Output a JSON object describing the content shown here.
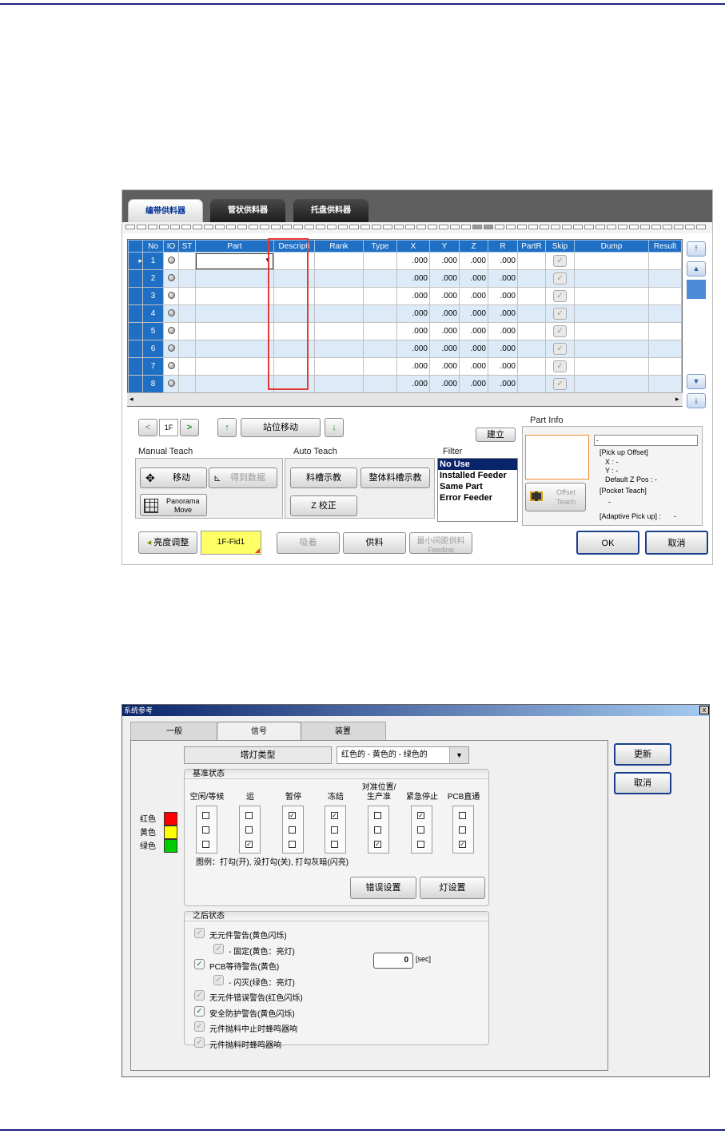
{
  "s1": {
    "tabs": [
      "编带供料器",
      "管状供料器",
      "托盘供料器"
    ],
    "columns": [
      "No",
      "IO",
      "ST",
      "Part",
      "Descripti",
      "Rank",
      "Type",
      "X",
      "Y",
      "Z",
      "R",
      "PartR",
      "Skip",
      "Dump",
      "Result"
    ],
    "rows": [
      {
        "no": "1",
        "x": ".000",
        "y": ".000",
        "z": ".000",
        "r": ".000"
      },
      {
        "no": "2",
        "x": ".000",
        "y": ".000",
        "z": ".000",
        "r": ".000"
      },
      {
        "no": "3",
        "x": ".000",
        "y": ".000",
        "z": ".000",
        "r": ".000"
      },
      {
        "no": "4",
        "x": ".000",
        "y": ".000",
        "z": ".000",
        "r": ".000"
      },
      {
        "no": "5",
        "x": ".000",
        "y": ".000",
        "z": ".000",
        "r": ".000"
      },
      {
        "no": "6",
        "x": ".000",
        "y": ".000",
        "z": ".000",
        "r": ".000"
      },
      {
        "no": "7",
        "x": ".000",
        "y": ".000",
        "z": ".000",
        "r": ".000"
      },
      {
        "no": "8",
        "x": ".000",
        "y": ".000",
        "z": ".000",
        "r": ".000"
      }
    ],
    "nav": {
      "prev": "<",
      "value": "1F",
      "next": ">",
      "up": "↑",
      "station_move": "站位移动",
      "down": "↓",
      "build": "建立"
    },
    "manual_teach": {
      "label": "Manual Teach",
      "move": "移动",
      "get_data": "得到数据",
      "panorama_1": "Panorama",
      "panorama_2": "Move"
    },
    "auto_teach": {
      "label": "Auto Teach",
      "slot_teach": "料槽示教",
      "all_slot_teach": "整体料槽示教",
      "z_correct": "Z 校正"
    },
    "filter": {
      "label": "Filter",
      "options": [
        "No Use",
        "Installed Feeder",
        "Same Part",
        "Error Feeder"
      ],
      "selected": "No Use"
    },
    "part_info": {
      "label": "Part Info",
      "value": "-",
      "pickup_offset": "[Pick up Offset]",
      "x": "X : -",
      "y": "Y : -",
      "default_z": "Default Z Pos : -",
      "pocket_teach": "[Pocket Teach]",
      "pocket_value": "-",
      "adaptive": "[Adaptive Pick up] :",
      "adaptive_value": "-",
      "offset_teach_1": "Offset",
      "offset_teach_2": "Teach"
    },
    "bottom": {
      "brightness": "亮度调整",
      "fid": "1F-Fid1",
      "pickup": "吸着",
      "supply": "供料",
      "min_feed_1": "最小间距供料",
      "min_feed_2": "Feeding",
      "ok": "OK",
      "cancel": "取消"
    }
  },
  "s2": {
    "title": "系统参考",
    "close": "x",
    "tabs": [
      "一般",
      "信号",
      "装置"
    ],
    "active_tab": "信号",
    "tower_type_label": "塔灯类型",
    "tower_type_value": "红色的 - 黄色的 - 绿色的",
    "update": "更新",
    "cancel": "取消",
    "base_state": "基准状态",
    "colors": [
      "红色",
      "黄色",
      "绿色"
    ],
    "color_hex": [
      "#ff0000",
      "#ffff00",
      "#00cc00"
    ],
    "columns": [
      {
        "label": "空闲/等候",
        "checks": [
          "",
          "",
          ""
        ]
      },
      {
        "label": "运",
        "checks": [
          "",
          "",
          "✓"
        ]
      },
      {
        "label": "暂停",
        "checks": [
          "✓",
          "",
          ""
        ]
      },
      {
        "label": "冻结",
        "checks": [
          "✓",
          "",
          ""
        ]
      },
      {
        "label": "对准位置/\n生产准",
        "checks": [
          "",
          "",
          "✓"
        ]
      },
      {
        "label": "紧急停止",
        "checks": [
          "✓",
          "",
          ""
        ]
      },
      {
        "label": "PCB直通",
        "checks": [
          "",
          "",
          "✓"
        ]
      }
    ],
    "legend": "图例：打勾(开), 没打勾(关), 打勾灰暗(闪亮)",
    "error_settings": "错误设置",
    "light_settings": "灯设置",
    "after_state": "之后状态",
    "options": [
      {
        "label": "无元件警告(黄色闪烁)",
        "checked": false,
        "indent": 0
      },
      {
        "label": "- 固定(黄色：亮灯)",
        "checked": false,
        "indent": 1
      },
      {
        "label": "PCB等待警告(黄色)",
        "checked": true,
        "indent": 0
      },
      {
        "label": "- 闪灭(绿色：亮灯)",
        "checked": false,
        "indent": 1
      },
      {
        "label": "无元件错误警告(红色闪烁)",
        "checked": false,
        "indent": 0
      },
      {
        "label": "安全防护警告(黄色闪烁)",
        "checked": true,
        "indent": 0
      },
      {
        "label": "元件抛料中止时蜂鸣器响",
        "checked": false,
        "indent": 0
      },
      {
        "label": "元件抛料时蜂鸣器响",
        "checked": false,
        "indent": 0
      }
    ],
    "sec_value": "0",
    "sec_unit": "[sec]"
  }
}
